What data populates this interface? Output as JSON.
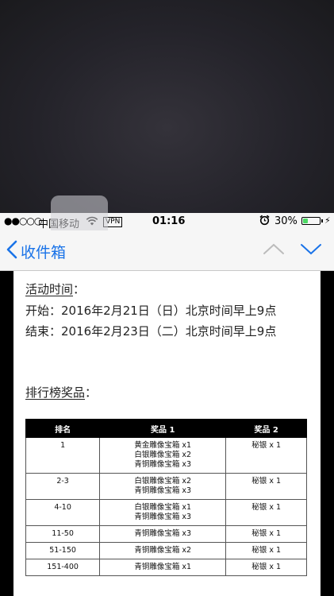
{
  "status_bar": {
    "signal_dots": "●●○○○",
    "carrier": "中国移动",
    "vpn": "VPN",
    "time": "01:16",
    "battery_pct": "30%",
    "battery_level": 0.3
  },
  "nav": {
    "back_label": "收件箱"
  },
  "email": {
    "activity_time_heading": "活动时间",
    "activity_colon": "：",
    "start_line": "开始：2016年2月21日（日）北京时间早上9点",
    "end_line": "结束：2016年2月23日（二）北京时间早上9点",
    "rank_heading": "排行榜奖品",
    "rank_colon": "：",
    "table": {
      "headers": [
        "排名",
        "奖品 1",
        "奖品 2"
      ],
      "rows": [
        {
          "rank": "1",
          "prize1": [
            "黄金雕像宝箱 x1",
            "白银雕像宝箱 x2",
            "青铜雕像宝箱 x3"
          ],
          "prize2": "秘银 x 1"
        },
        {
          "rank": "2-3",
          "prize1": [
            "白银雕像宝箱 x2",
            "青铜雕像宝箱 x3"
          ],
          "prize2": "秘银 x 1"
        },
        {
          "rank": "4-10",
          "prize1": [
            "白银雕像宝箱 x1",
            "青铜雕像宝箱 x3"
          ],
          "prize2": "秘银 x 1"
        },
        {
          "rank": "11-50",
          "prize1": [
            "青铜雕像宝箱 x3"
          ],
          "prize2": "秘银 x 1"
        },
        {
          "rank": "51-150",
          "prize1": [
            "青铜雕像宝箱 x2"
          ],
          "prize2": "秘银 x 1"
        },
        {
          "rank": "151-400",
          "prize1": [
            "青铜雕像宝箱 x1"
          ],
          "prize2": "秘银 x 1"
        }
      ]
    }
  }
}
